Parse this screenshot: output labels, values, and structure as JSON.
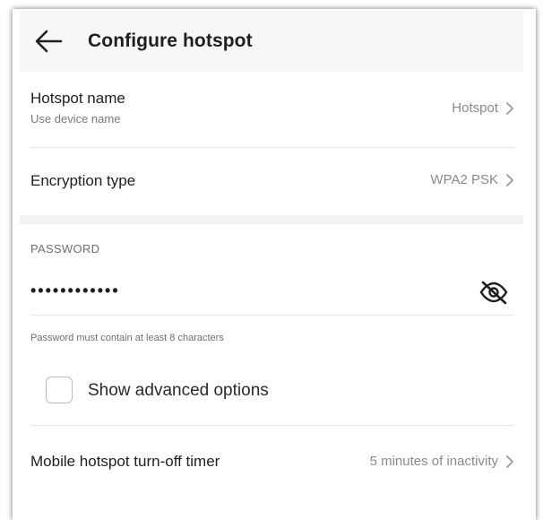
{
  "header": {
    "title": "Configure hotspot"
  },
  "hotspot_name": {
    "label": "Hotspot name",
    "sublabel": "Use device name",
    "value": "Hotspot"
  },
  "encryption": {
    "label": "Encryption type",
    "value": "WPA2 PSK"
  },
  "password": {
    "section_label": "PASSWORD",
    "masked_value": "••••••••••••",
    "hint": "Password must contain at least 8 characters"
  },
  "advanced": {
    "label": "Show advanced options",
    "checked": false
  },
  "timer": {
    "label": "Mobile hotspot turn-off timer",
    "value": "5 minutes of inactivity"
  },
  "icons": {
    "back": "back-arrow-icon",
    "visibility": "eye-off-icon",
    "chevron": "chevron-right-icon"
  }
}
